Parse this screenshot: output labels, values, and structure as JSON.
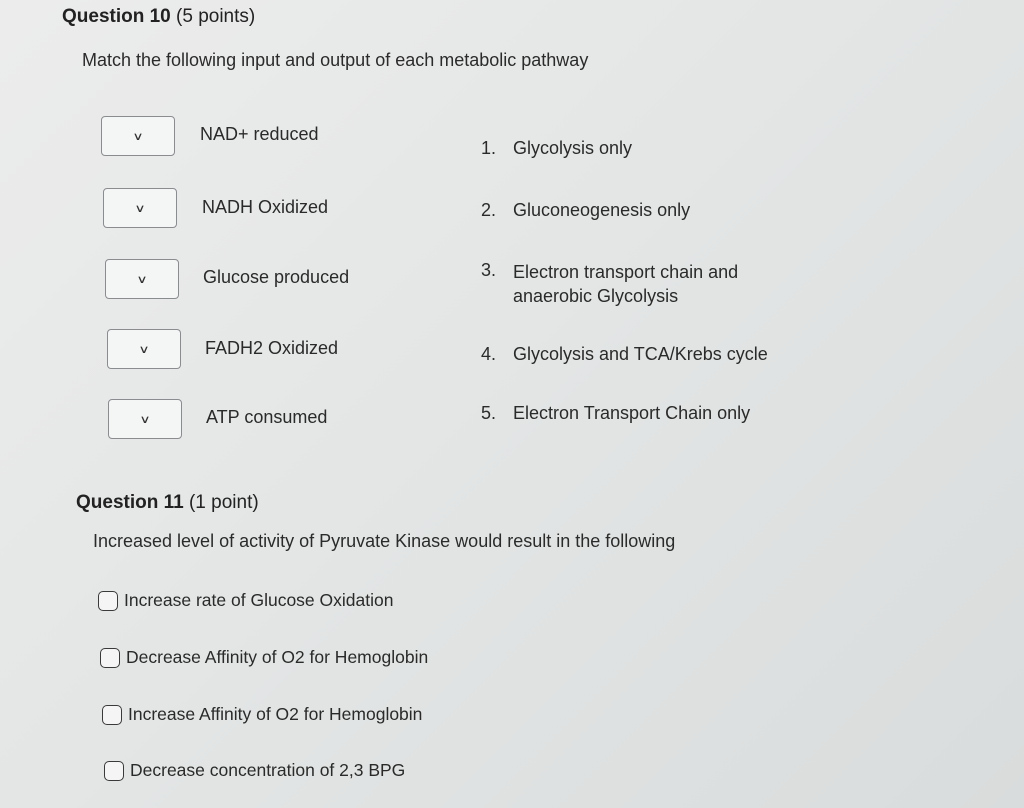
{
  "q10": {
    "title_bold": "Question 10",
    "title_points": "(5 points)",
    "prompt": "Match the following input and output of each metabolic pathway",
    "items": [
      {
        "label": "NAD+ reduced"
      },
      {
        "label": "NADH Oxidized"
      },
      {
        "label": "Glucose produced"
      },
      {
        "label": "FADH2 Oxidized"
      },
      {
        "label": "ATP consumed"
      }
    ],
    "options": [
      {
        "num": "1.",
        "line1": "Glycolysis only",
        "line2": ""
      },
      {
        "num": "2.",
        "line1": "Gluconeogenesis only",
        "line2": ""
      },
      {
        "num": "3.",
        "line1": "Electron transport chain and",
        "line2": "anaerobic Glycolysis"
      },
      {
        "num": "4.",
        "line1": "Glycolysis and TCA/Krebs cycle",
        "line2": ""
      },
      {
        "num": "5.",
        "line1": "Electron Transport Chain only",
        "line2": ""
      }
    ]
  },
  "q11": {
    "title_bold": "Question 11",
    "title_points": "(1 point)",
    "prompt": "Increased level of activity of Pyruvate Kinase would result in the following",
    "choices": [
      {
        "label": "Increase rate of Glucose Oxidation"
      },
      {
        "label": "Decrease Affinity of O2 for Hemoglobin"
      },
      {
        "label": "Increase Affinity of O2 for Hemoglobin"
      },
      {
        "label": "Decrease concentration of 2,3 BPG"
      }
    ]
  },
  "icons": {
    "dropdown": "chevron-down-icon",
    "radio": "radio-button"
  }
}
